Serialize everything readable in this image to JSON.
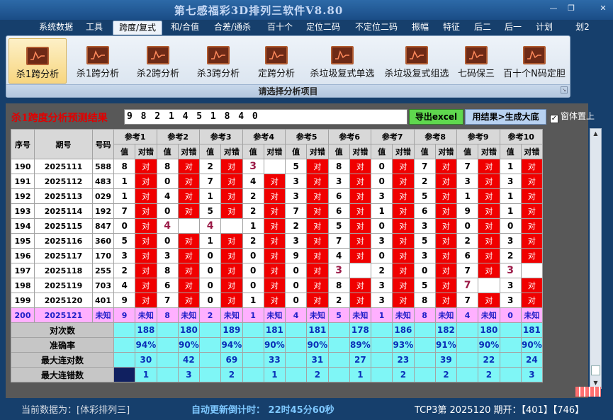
{
  "app": {
    "title": "第七感福彩3D排列三软件V8.80",
    "min": "—",
    "max": "❐",
    "close": "✕"
  },
  "menu": [
    "系统数据",
    "工具",
    "跨度/复式",
    "和/合值",
    "合差/通杀",
    "百十个",
    "定位二码",
    "不定位二码",
    "振幅",
    "特征",
    "后二",
    "后一",
    "计划",
    "划2"
  ],
  "ribbon": {
    "buttons": [
      "杀1跨分析",
      "杀1跨分析",
      "杀2跨分析",
      "杀3跨分析",
      "定跨分析",
      "杀垃圾复式单选",
      "杀垃圾复式组选",
      "七码保三",
      "百十个N码定胆"
    ],
    "group_label": "请选择分析项目"
  },
  "analysis": {
    "title": "杀1跨度分析预测结果",
    "result": "9 8 2 1 4 5 1 8 4 0",
    "export_label": "导出excel",
    "generate_label": "用结果>生成大底",
    "topmost_label": "窗体置上",
    "topmost_checked": "✓"
  },
  "table": {
    "h_index": "序号",
    "h_period": "期号",
    "h_number": "号码",
    "h_value": "值",
    "h_judge": "对错",
    "refs": [
      "参考1",
      "参考2",
      "参考3",
      "参考4",
      "参考5",
      "参考6",
      "参考7",
      "参考8",
      "参考9",
      "参考10"
    ],
    "rows": [
      {
        "idx": "190",
        "period": "2025111",
        "num": "588",
        "cells": [
          [
            "8",
            "对"
          ],
          [
            "8",
            "对"
          ],
          [
            "2",
            "对"
          ],
          [
            "3",
            ""
          ],
          [
            "5",
            "对"
          ],
          [
            "8",
            "对"
          ],
          [
            "0",
            "对"
          ],
          [
            "7",
            "对"
          ],
          [
            "7",
            "对"
          ],
          [
            "1",
            "对"
          ]
        ]
      },
      {
        "idx": "191",
        "period": "2025112",
        "num": "483",
        "cells": [
          [
            "1",
            "对"
          ],
          [
            "0",
            "对"
          ],
          [
            "7",
            "对"
          ],
          [
            "4",
            "对"
          ],
          [
            "3",
            "对"
          ],
          [
            "3",
            "对"
          ],
          [
            "0",
            "对"
          ],
          [
            "2",
            "对"
          ],
          [
            "3",
            "对"
          ],
          [
            "3",
            "对"
          ]
        ]
      },
      {
        "idx": "192",
        "period": "2025113",
        "num": "029",
        "cells": [
          [
            "1",
            "对"
          ],
          [
            "4",
            "对"
          ],
          [
            "1",
            "对"
          ],
          [
            "2",
            "对"
          ],
          [
            "3",
            "对"
          ],
          [
            "6",
            "对"
          ],
          [
            "3",
            "对"
          ],
          [
            "5",
            "对"
          ],
          [
            "1",
            "对"
          ],
          [
            "1",
            "对"
          ]
        ]
      },
      {
        "idx": "193",
        "period": "2025114",
        "num": "192",
        "cells": [
          [
            "7",
            "对"
          ],
          [
            "0",
            "对"
          ],
          [
            "5",
            "对"
          ],
          [
            "2",
            "对"
          ],
          [
            "7",
            "对"
          ],
          [
            "6",
            "对"
          ],
          [
            "1",
            "对"
          ],
          [
            "6",
            "对"
          ],
          [
            "9",
            "对"
          ],
          [
            "1",
            "对"
          ]
        ]
      },
      {
        "idx": "194",
        "period": "2025115",
        "num": "847",
        "cells": [
          [
            "0",
            "对"
          ],
          [
            "4",
            ""
          ],
          [
            "4",
            ""
          ],
          [
            "1",
            "对"
          ],
          [
            "2",
            "对"
          ],
          [
            "5",
            "对"
          ],
          [
            "0",
            "对"
          ],
          [
            "3",
            "对"
          ],
          [
            "0",
            "对"
          ],
          [
            "0",
            "对"
          ]
        ]
      },
      {
        "idx": "195",
        "period": "2025116",
        "num": "360",
        "cells": [
          [
            "5",
            "对"
          ],
          [
            "0",
            "对"
          ],
          [
            "1",
            "对"
          ],
          [
            "2",
            "对"
          ],
          [
            "3",
            "对"
          ],
          [
            "7",
            "对"
          ],
          [
            "3",
            "对"
          ],
          [
            "5",
            "对"
          ],
          [
            "2",
            "对"
          ],
          [
            "3",
            "对"
          ]
        ]
      },
      {
        "idx": "196",
        "period": "2025117",
        "num": "170",
        "cells": [
          [
            "3",
            "对"
          ],
          [
            "3",
            "对"
          ],
          [
            "0",
            "对"
          ],
          [
            "0",
            "对"
          ],
          [
            "9",
            "对"
          ],
          [
            "4",
            "对"
          ],
          [
            "0",
            "对"
          ],
          [
            "3",
            "对"
          ],
          [
            "6",
            "对"
          ],
          [
            "2",
            "对"
          ]
        ]
      },
      {
        "idx": "197",
        "period": "2025118",
        "num": "255",
        "cells": [
          [
            "2",
            "对"
          ],
          [
            "8",
            "对"
          ],
          [
            "0",
            "对"
          ],
          [
            "0",
            "对"
          ],
          [
            "0",
            "对"
          ],
          [
            "3",
            ""
          ],
          [
            "2",
            "对"
          ],
          [
            "0",
            "对"
          ],
          [
            "7",
            "对"
          ],
          [
            "3",
            ""
          ]
        ]
      },
      {
        "idx": "198",
        "period": "2025119",
        "num": "703",
        "cells": [
          [
            "4",
            "对"
          ],
          [
            "6",
            "对"
          ],
          [
            "0",
            "对"
          ],
          [
            "0",
            "对"
          ],
          [
            "0",
            "对"
          ],
          [
            "8",
            "对"
          ],
          [
            "3",
            "对"
          ],
          [
            "5",
            "对"
          ],
          [
            "7",
            ""
          ],
          [
            "3",
            "对"
          ]
        ]
      },
      {
        "idx": "199",
        "period": "2025120",
        "num": "401",
        "cells": [
          [
            "9",
            "对"
          ],
          [
            "7",
            "对"
          ],
          [
            "0",
            "对"
          ],
          [
            "1",
            "对"
          ],
          [
            "0",
            "对"
          ],
          [
            "2",
            "对"
          ],
          [
            "3",
            "对"
          ],
          [
            "8",
            "对"
          ],
          [
            "7",
            "对"
          ],
          [
            "3",
            "对"
          ]
        ]
      }
    ],
    "pred_row": {
      "idx": "200",
      "period": "2025121",
      "num": "未知",
      "values": [
        "9",
        "8",
        "2",
        "1",
        "4",
        "5",
        "1",
        "8",
        "4",
        "0"
      ],
      "unknown": "未知"
    },
    "stats": [
      {
        "label": "对次数",
        "values": [
          "188",
          "180",
          "189",
          "181",
          "181",
          "178",
          "186",
          "182",
          "180",
          "181"
        ]
      },
      {
        "label": "准确率",
        "values": [
          "94%",
          "90%",
          "94%",
          "90%",
          "90%",
          "89%",
          "93%",
          "91%",
          "90%",
          "90%"
        ]
      },
      {
        "label": "最大连对数",
        "values": [
          "30",
          "42",
          "69",
          "33",
          "31",
          "27",
          "23",
          "39",
          "22",
          "24"
        ]
      },
      {
        "label": "最大连错数",
        "values": [
          "1",
          "3",
          "2",
          "1",
          "2",
          "1",
          "2",
          "2",
          "2",
          "3"
        ]
      }
    ]
  },
  "status": {
    "left": "当前数据为：[体彩排列三]",
    "countdown": "自动更新倒计时： 22时45分60秒",
    "right": "TCP3第 2025120 期开：【401】【746】"
  }
}
